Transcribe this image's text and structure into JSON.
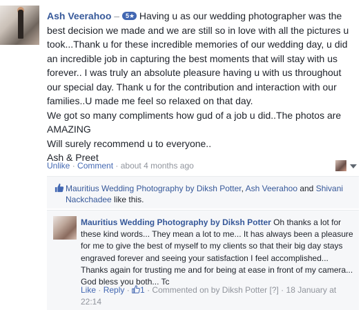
{
  "review": {
    "author": "Ash Veerahoo",
    "dash": "–",
    "rating_badge": "5★",
    "text_first": "Having u as our wedding photographer was the best decision we made and we are still so in love with all the pictures u took...Thank u for these incredible memories of our wedding day, u did an incredible job in capturing the best moments that will stay with us forever.. I was truly an absolute pleasure having u with us throughout our special day. Thank u for the contribution and interaction with our families..U made me feel so relaxed on that day.",
    "text_rest": "We got so many compliments how gud of a job u did..The photos are AMAZING\nWill surely recommend u to everyone..\nAsh & Preet",
    "actions": {
      "unlike": "Unlike",
      "sep1": " · ",
      "comment": "Comment",
      "sep2": " · ",
      "time": "about 4 months ago"
    }
  },
  "likes": {
    "user1": "Mauritius Wedding Photography by Diksh Potter",
    "sep1": ", ",
    "user2": "Ash Veerahoo",
    "and": " and ",
    "user3": "Shivani Nackchadee",
    "suffix": " like this."
  },
  "reply": {
    "author": "Mauritius Wedding Photography by Diksh Potter",
    "text": " Oh thanks a lot for these kind words... They mean a lot to me... It has always been a pleasure for me to give the best of myself to my clients so that their big day stays engraved forever and seeing your satisfaction I feel accomplished... Thanks again for trusting me and for being at ease in front of my camera... God bless you both... Tc",
    "like": "Like",
    "sep1": " · ",
    "reply": "Reply",
    "sep2": " · ",
    "like_count": "1",
    "sep3": " · ",
    "commented_on": "Commented on by Diksh Potter",
    "help": " [?]",
    "sep4": " · ",
    "date": "18 January at 22:14"
  },
  "colors": {
    "link": "#365899",
    "action": "#4267b2",
    "meta": "#90949c",
    "panel": "#f6f7f9"
  }
}
